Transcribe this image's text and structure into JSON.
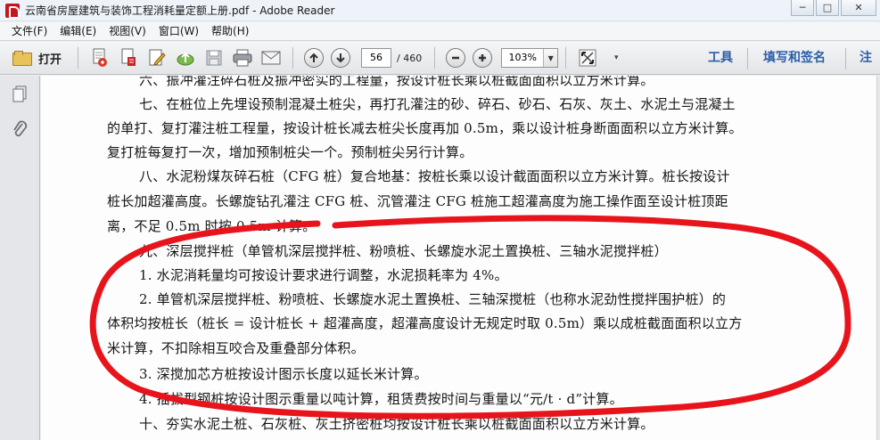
{
  "window": {
    "title": "云南省房屋建筑与装饰工程消耗量定额上册.pdf - Adobe Reader",
    "controls": [
      "─",
      "□",
      "✕"
    ]
  },
  "menu": [
    "文件(F)",
    "编辑(E)",
    "视图(V)",
    "窗口(W)",
    "帮助(H)"
  ],
  "toolbar": {
    "open_label": "打开",
    "page_current": "56",
    "page_total": "/ 460",
    "zoom": "103%",
    "tools_label": "工具",
    "fill_sign_label": "填写和签名",
    "comment_label": "注释"
  },
  "document": {
    "lines": [
      "六、振冲灌注碎石桩及振冲密实的工程量，按设计桩长乘以桩截面面积以立方米计算。",
      "七、在桩位上先埋设预制混凝土桩尖，再打孔灌注的砂、碎石、砂石、石灰、灰土、水泥土与混凝土",
      "的单打、复打灌注桩工程量，按设计桩长减去桩尖长度再加 0.5m，乘以设计桩身断面面积以立方米计算。",
      "复打桩每复打一次，增加预制桩尖一个。预制桩尖另行计算。",
      "八、水泥粉煤灰碎石桩（CFG 桩）复合地基：按桩长乘以设计截面面积以立方米计算。桩长按设计",
      "桩长加超灌高度。长螺旋钻孔灌注 CFG 桩、沉管灌注 CFG 桩施工超灌高度为施工操作面至设计桩顶距",
      "离，不足 0.5m 时按 0.5m 计算。",
      "九、深层搅拌桩（单管机深层搅拌桩、粉喷桩、长螺旋水泥土置换桩、三轴水泥搅拌桩）",
      "1. 水泥消耗量均可按设计要求进行调整，水泥损耗率为 4%。",
      "2. 单管机深层搅拌桩、粉喷桩、长螺旋水泥土置换桩、三轴深搅桩（也称水泥劲性搅拌围护桩）的",
      "体积均按桩长（桩长 = 设计桩长 + 超灌高度，超灌高度设计无规定时取 0.5m）乘以成桩截面面积以立方",
      "米计算，不扣除相互咬合及重叠部分体积。",
      "3. 深搅加芯方桩按设计图示长度以延长米计算。",
      "4. 插拔型钢桩按设计图示重量以吨计算，租赁费按时间与重量以“元/t · d”计算。",
      "十、夯实水泥土桩、石灰桩、灰土挤密桩均按设计桩长乘以桩截面面积以立方米计算。"
    ]
  },
  "colors": {
    "annotation": "#e8141c",
    "link": "#2b5ea8"
  },
  "icons": [
    "pdf-app-icon",
    "folder-icon",
    "create-pdf-icon",
    "convert-icon",
    "edit-icon",
    "upload-icon",
    "save-icon",
    "print-icon",
    "email-icon",
    "page-up-icon",
    "page-down-icon",
    "zoom-out-icon",
    "zoom-in-icon",
    "fit-page-icon",
    "pages-panel-icon",
    "attachment-icon"
  ]
}
